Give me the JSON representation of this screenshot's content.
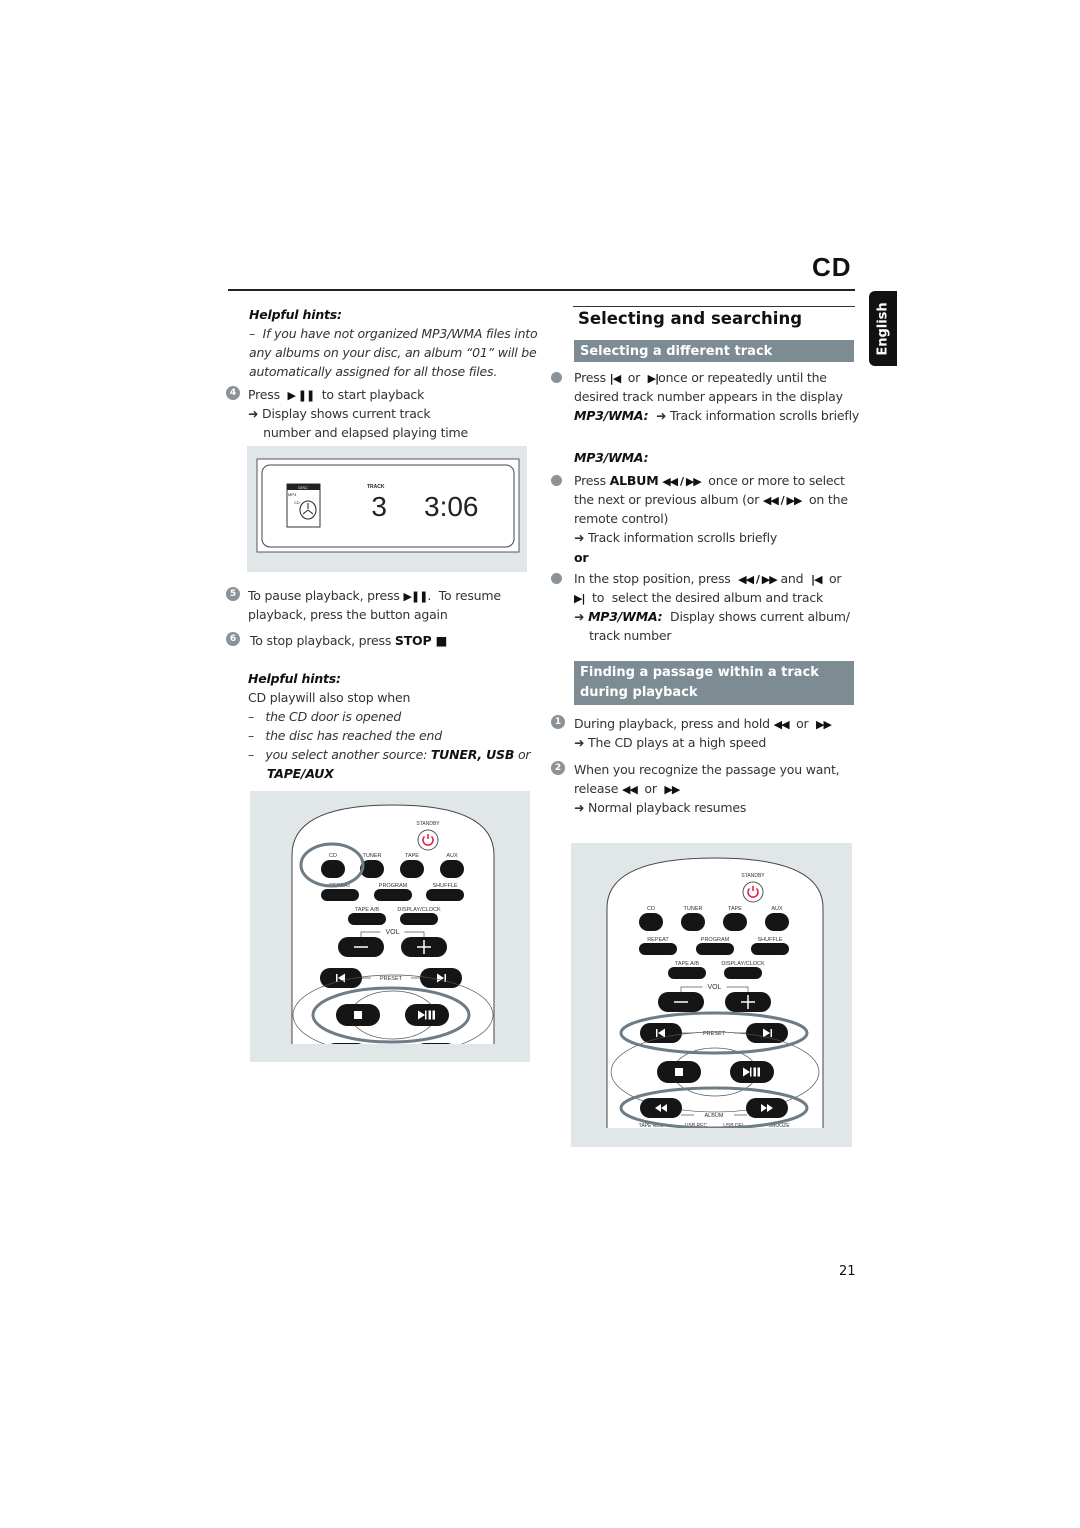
{
  "header": {
    "section": "CD",
    "language_tab": "English"
  },
  "left": {
    "hints1": {
      "title": "Helpful hints:",
      "lines": [
        [
          {
            "t": "–  If you have not organized MP3/WMA files into",
            "c": "i"
          }
        ],
        [
          {
            "t": "any albums on your disc, an album “01” will be",
            "c": "i"
          }
        ],
        [
          {
            "t": "automatically assigned for all those files.",
            "c": "i"
          }
        ]
      ]
    },
    "step4": {
      "num": "4",
      "lines": [
        [
          {
            "t": "Press  ",
            "c": ""
          },
          {
            "t": "▶ ❚❚",
            "c": "sym"
          },
          {
            "t": "  to start playback",
            "c": ""
          }
        ],
        [
          {
            "t": "➜ Display shows current track",
            "c": ""
          }
        ],
        [
          {
            "t": "    number and elapsed playing time",
            "c": ""
          }
        ]
      ]
    },
    "display": {
      "disc_label": "DISC",
      "mp3_label": "MP3",
      "cd_label": "CD",
      "track_label": "TRACK",
      "track": "3",
      "time": "3:06"
    },
    "step5": {
      "num": "5",
      "lines": [
        [
          {
            "t": "To pause playback, press ",
            "c": ""
          },
          {
            "t": "▶❚❚",
            "c": "sym"
          },
          {
            "t": ".  To resume",
            "c": ""
          }
        ],
        [
          {
            "t": "playback, press the button again",
            "c": ""
          }
        ]
      ]
    },
    "step6": {
      "num": "6",
      "lines": [
        [
          {
            "t": "To stop playback, press ",
            "c": ""
          },
          {
            "t": "STOP ■",
            "c": "b"
          }
        ]
      ]
    },
    "hints2": {
      "title": "Helpful hints:",
      "lines": [
        [
          {
            "t": "CD playwill also stop when",
            "c": ""
          }
        ],
        [
          {
            "t": "–   the CD door is opened",
            "c": "i"
          }
        ],
        [
          {
            "t": "–   the disc has reached the end",
            "c": "i"
          }
        ],
        [
          {
            "t": "–   you select another source: ",
            "c": "i"
          },
          {
            "t": "TUNER, USB",
            "c": "bi"
          },
          {
            "t": " or",
            "c": "i"
          }
        ],
        [
          {
            "t": "     ",
            "c": ""
          },
          {
            "t": "TAPE/AUX",
            "c": "bi"
          }
        ]
      ]
    }
  },
  "right": {
    "title": "Selecting and searching",
    "bar1": "Selecting a different track",
    "b1": [
      [
        {
          "t": "Press ",
          "c": ""
        },
        {
          "t": "|◀",
          "c": "sym"
        },
        {
          "t": "  or  ",
          "c": ""
        },
        {
          "t": "▶|",
          "c": "sym"
        },
        {
          "t": "once or repeatedly until the",
          "c": ""
        }
      ],
      [
        {
          "t": "desired track number appears in the display",
          "c": ""
        }
      ],
      [
        {
          "t": "MP3/WMA:",
          "c": "bi"
        },
        {
          "t": "  ➜ Track information scrolls briefly",
          "c": ""
        }
      ]
    ],
    "mp3_heading": "MP3/WMA:",
    "b2": [
      [
        {
          "t": "Press ",
          "c": ""
        },
        {
          "t": "ALBUM",
          "c": "b"
        },
        {
          "t": " ",
          "c": ""
        },
        {
          "t": "◀◀ / ▶▶",
          "c": "sym"
        },
        {
          "t": "  once or more to select",
          "c": ""
        }
      ],
      [
        {
          "t": "the next or previous album (or ",
          "c": ""
        },
        {
          "t": "◀◀ / ▶▶",
          "c": "sym"
        },
        {
          "t": "  on the",
          "c": ""
        }
      ],
      [
        {
          "t": "remote control)",
          "c": ""
        }
      ],
      [
        {
          "t": "➜ Track information scrolls briefly",
          "c": ""
        }
      ]
    ],
    "or": "or",
    "b3": [
      [
        {
          "t": "In the stop position, press  ",
          "c": ""
        },
        {
          "t": "◀◀ / ▶▶",
          "c": "sym"
        },
        {
          "t": " and  ",
          "c": ""
        },
        {
          "t": "|◀",
          "c": "sym"
        },
        {
          "t": "  or",
          "c": ""
        }
      ],
      [
        {
          "t": "▶|",
          "c": "sym"
        },
        {
          "t": "  to  select the desired album and track",
          "c": ""
        }
      ],
      [
        {
          "t": "➜ ",
          "c": ""
        },
        {
          "t": "MP3/WMA:",
          "c": "bi"
        },
        {
          "t": "  Display shows current album/",
          "c": ""
        }
      ],
      [
        {
          "t": "    track number",
          "c": ""
        }
      ]
    ],
    "bar2": [
      "Finding a passage within a track",
      "during playback"
    ],
    "s1": {
      "num": "1",
      "lines": [
        [
          {
            "t": "During playback, press and hold ",
            "c": ""
          },
          {
            "t": "◀◀",
            "c": "sym"
          },
          {
            "t": "  or  ",
            "c": ""
          },
          {
            "t": "▶▶",
            "c": "sym"
          }
        ],
        [
          {
            "t": "➜ The CD plays at a high speed",
            "c": ""
          }
        ]
      ]
    },
    "s2": {
      "num": "2",
      "lines": [
        [
          {
            "t": "When you recognize the passage you want,",
            "c": ""
          }
        ],
        [
          {
            "t": "release ",
            "c": ""
          },
          {
            "t": "◀◀",
            "c": "sym"
          },
          {
            "t": "  or  ",
            "c": ""
          },
          {
            "t": "▶▶",
            "c": "sym"
          }
        ],
        [
          {
            "t": "➜ Normal playback resumes",
            "c": ""
          }
        ]
      ]
    }
  },
  "remote": {
    "standby": "STANDBY",
    "sources": [
      "CD",
      "TUNER",
      "TAPE",
      "AUX"
    ],
    "row2": [
      "REPEAT",
      "PROGRAM",
      "SHUFFLE"
    ],
    "row3": [
      "TAPE A/B",
      "DISPLAY/CLOCK"
    ],
    "vol": "VOL",
    "preset": "PRESET",
    "album": "ALBUM",
    "bottom": [
      "TAPE REC",
      "USB REC",
      "USB DEL",
      "SNOOZE"
    ],
    "highlight_color": "#6e7c86",
    "standby_color": "#e0193a"
  },
  "footer": {
    "page_number": "21"
  }
}
